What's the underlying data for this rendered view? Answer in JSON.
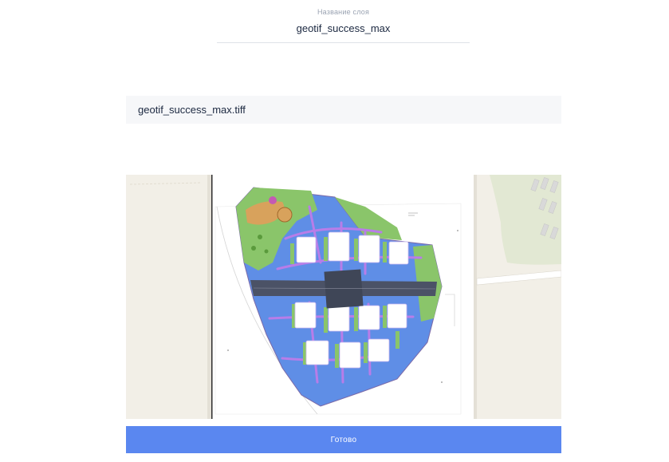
{
  "layer_name": {
    "label": "Название слоя",
    "value": "geotif_success_max"
  },
  "file": {
    "name": "geotif_success_max.tiff"
  },
  "preview": {
    "image": "geotiff-site-plan-preview",
    "colors": {
      "basemap": "#f2efe7",
      "roads": "#5f8ee6",
      "footpaths": "#b87de8",
      "greenery": "#8ac56a",
      "buildings": "#ffffff",
      "central_block": "#3f4657"
    }
  },
  "actions": {
    "done_label": "Готово"
  },
  "colors": {
    "primary_button": "#5a87f0",
    "input_background": "#f6f7f9",
    "text": "#1b2840",
    "muted_text": "#9aa3b2"
  }
}
